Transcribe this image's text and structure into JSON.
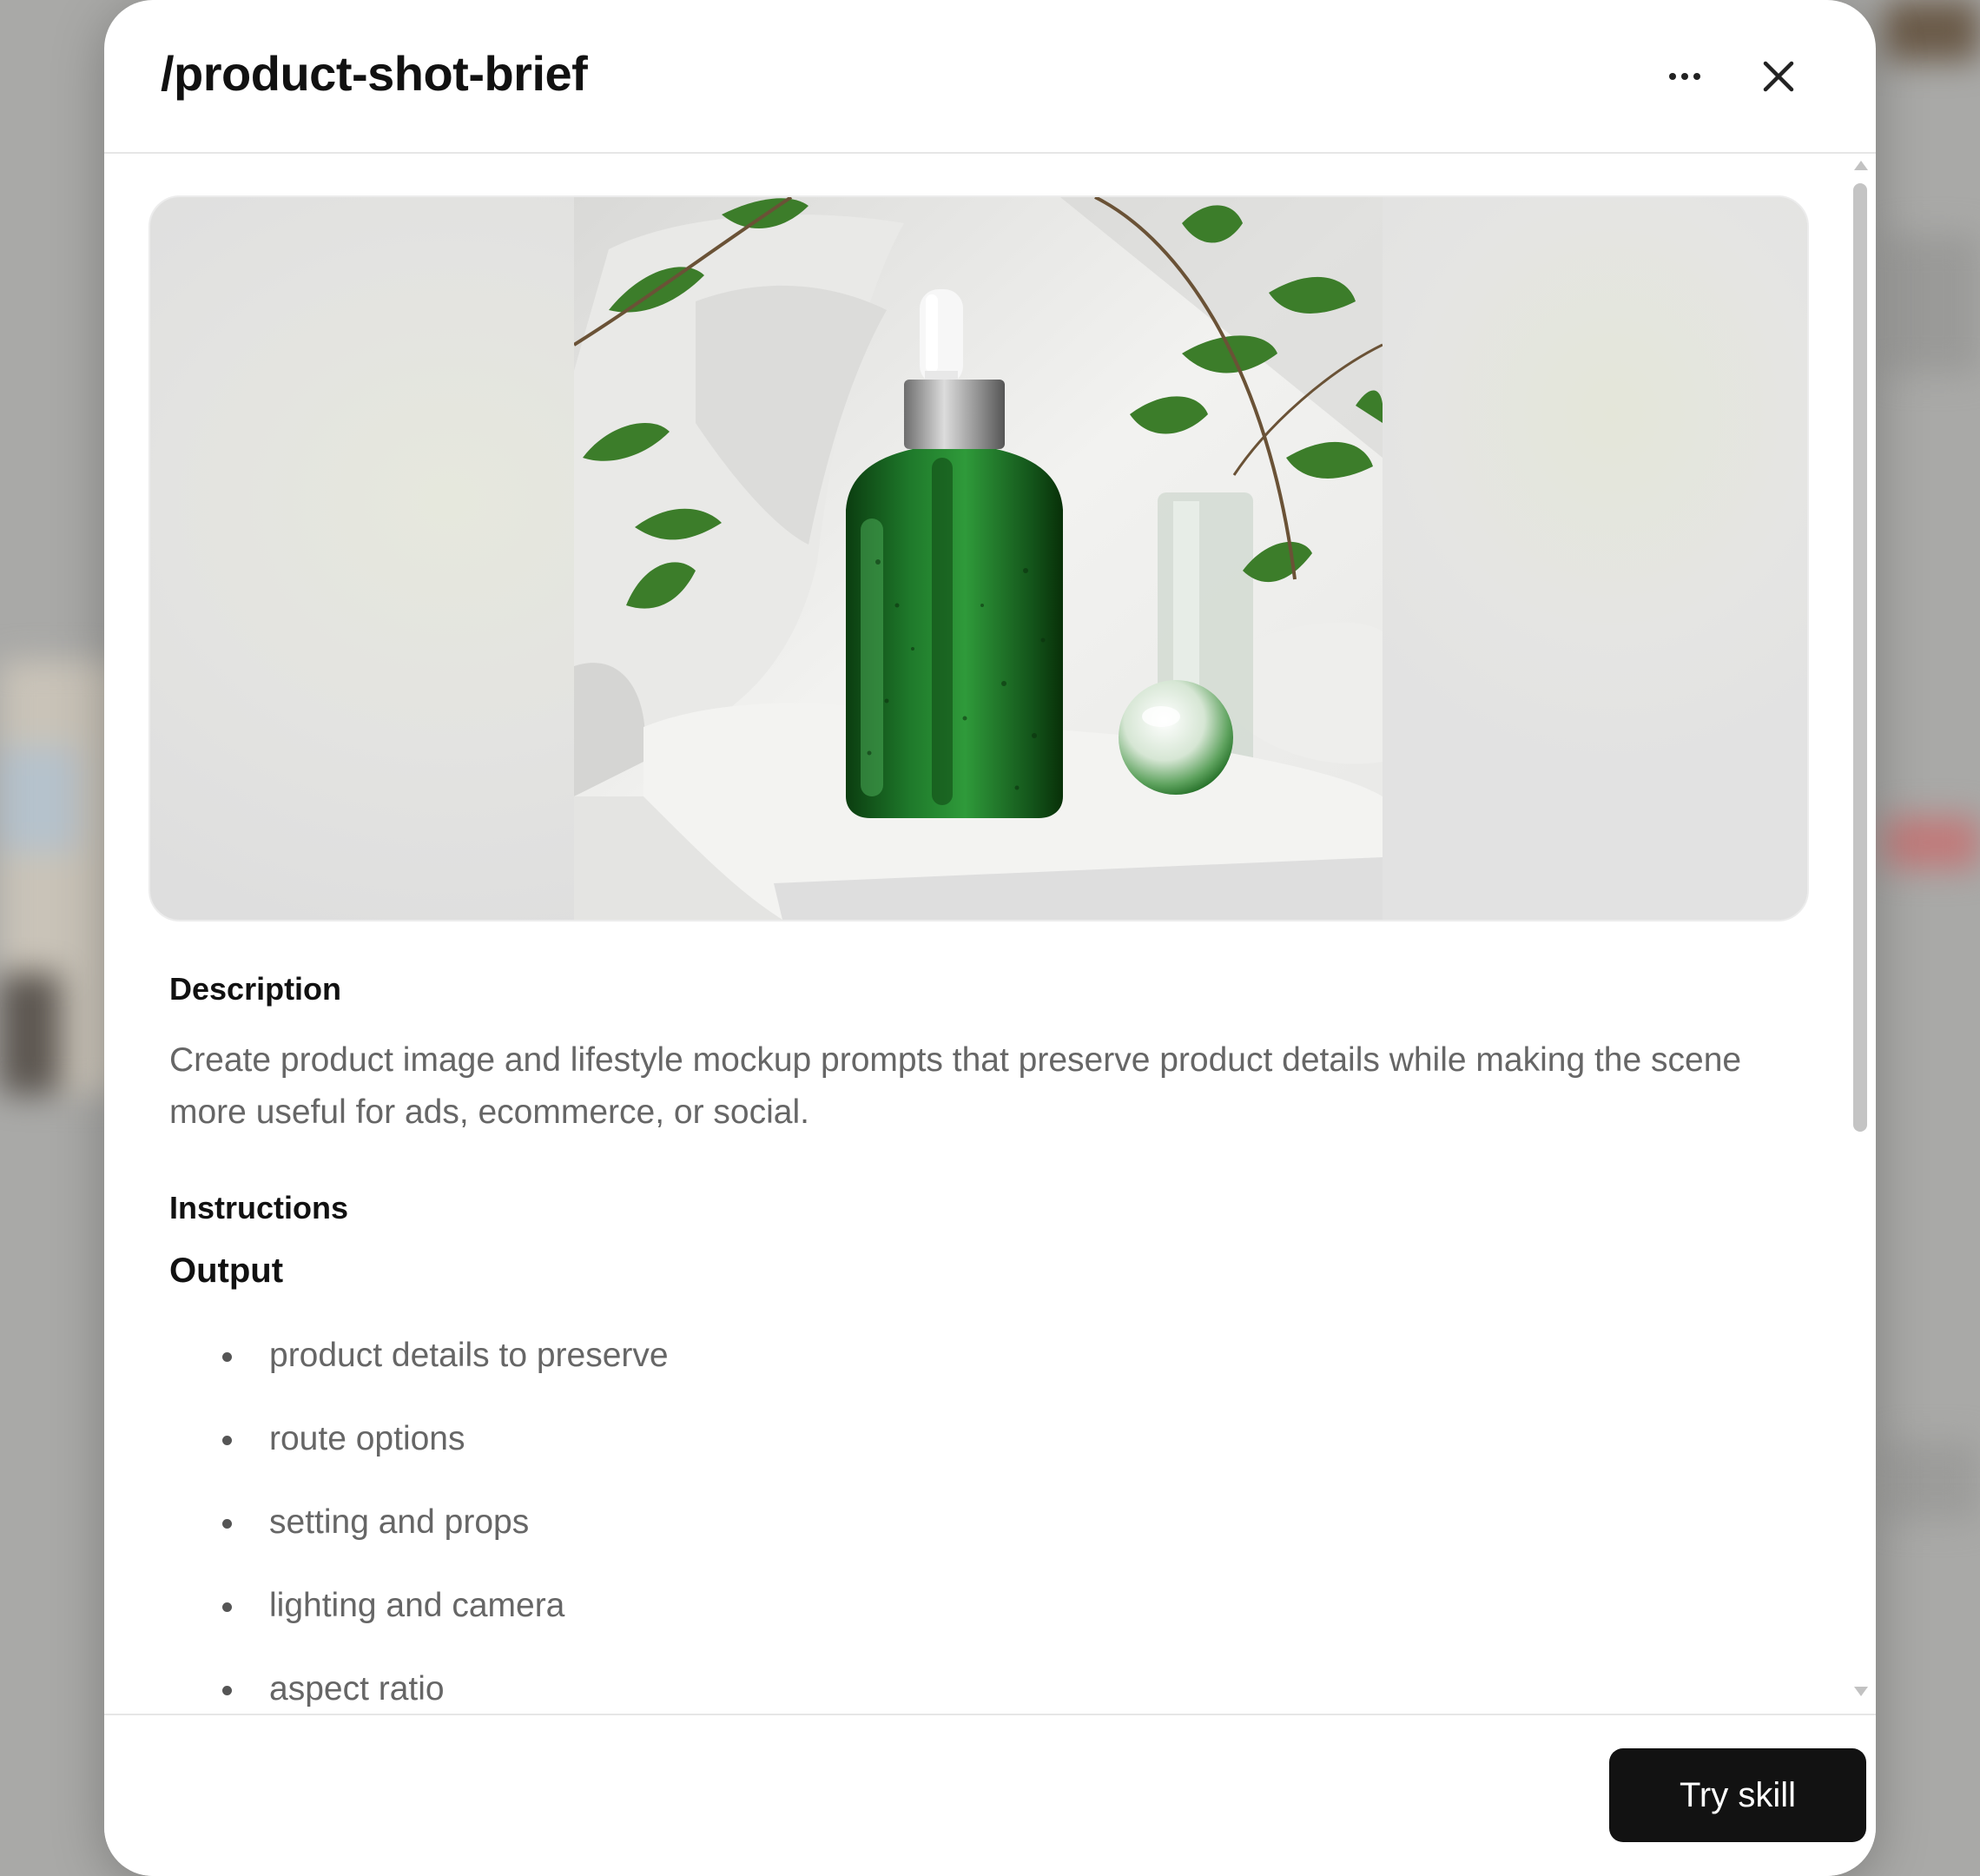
{
  "dialog": {
    "title": "/product-shot-brief",
    "more_icon": "more-horizontal-icon",
    "close_icon": "close-icon"
  },
  "hero": {
    "image": "green dropper serum bottle on white stone with leaves and glass sphere"
  },
  "description": {
    "heading": "Description",
    "text": "Create product image and lifestyle mockup prompts that preserve product details while making the scene more useful for ads, ecommerce, or social."
  },
  "instructions": {
    "heading": "Instructions",
    "output_heading": "Output",
    "items": [
      "product details to preserve",
      "route options",
      "setting and props",
      "lighting and camera",
      "aspect ratio"
    ]
  },
  "footer": {
    "try_label": "Try skill"
  },
  "colors": {
    "accent_button": "#121212",
    "bottle_green": "#1f7a2b",
    "text_muted": "#666666"
  }
}
